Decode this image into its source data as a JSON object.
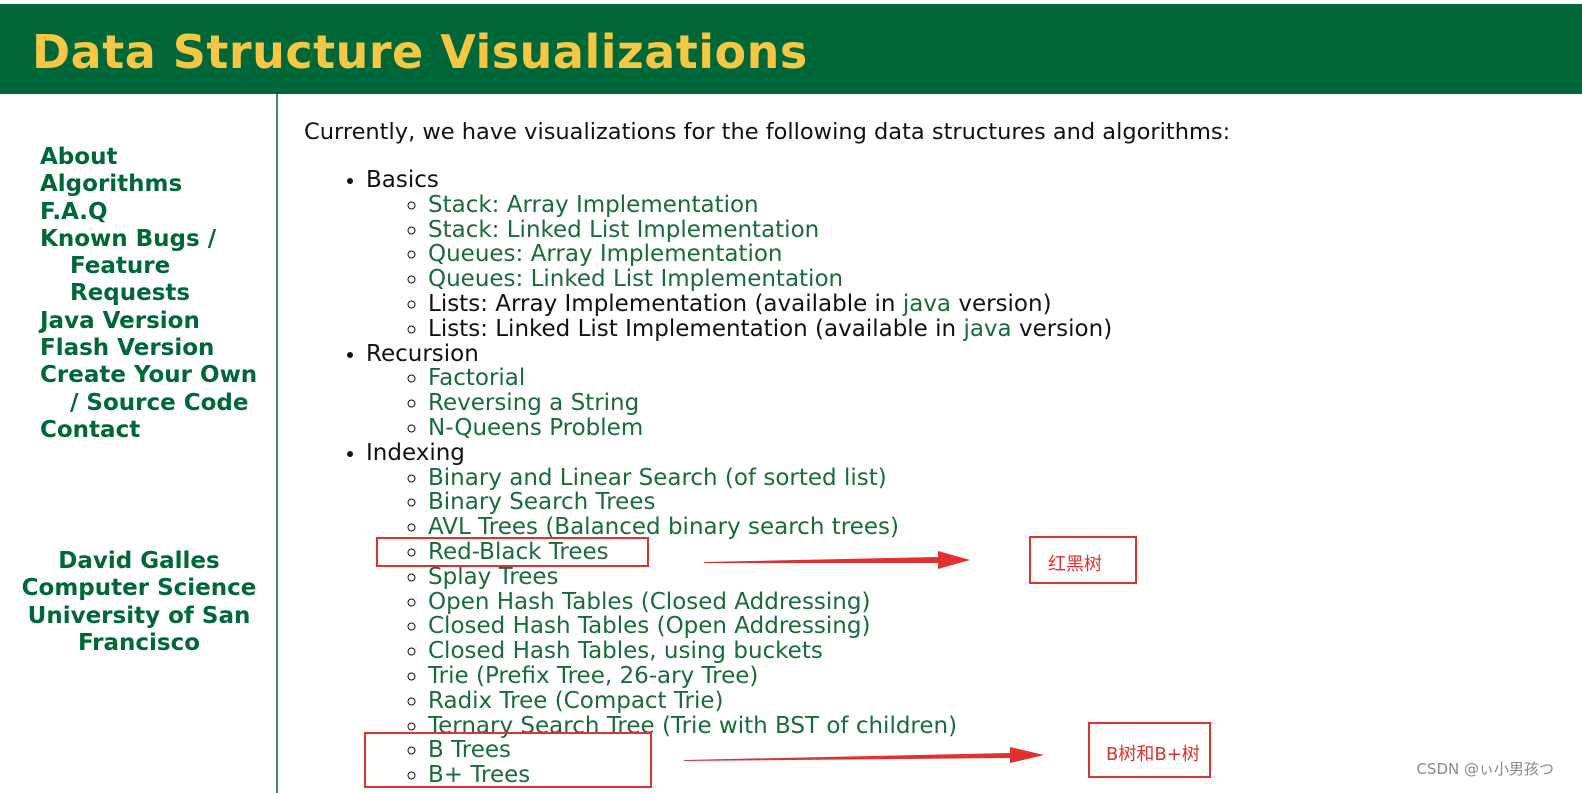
{
  "header": {
    "title": "Data Structure Visualizations"
  },
  "sidebar": {
    "links": [
      "About",
      "Algorithms",
      "F.A.Q",
      "Known Bugs / Feature Requests",
      "Java Version",
      "Flash Version",
      "Create Your Own / Source Code",
      "Contact"
    ],
    "author": [
      "David Galles",
      "Computer Science",
      "University of San",
      "Francisco"
    ]
  },
  "main": {
    "intro": "Currently, we have visualizations for the following data structures and algorithms:",
    "categories": [
      {
        "name": "Basics",
        "items": [
          "Stack: Array Implementation",
          "Stack: Linked List Implementation",
          "Queues: Array Implementation",
          "Queues: Linked List Implementation"
        ],
        "java_items": [
          {
            "prefix": "Lists: Array Implementation (available in ",
            "link": "java",
            "suffix": " version)"
          },
          {
            "prefix": "Lists: Linked List Implementation (available in ",
            "link": "java",
            "suffix": " version)"
          }
        ]
      },
      {
        "name": "Recursion",
        "items": [
          "Factorial",
          "Reversing a String",
          "N-Queens Problem"
        ]
      },
      {
        "name": "Indexing",
        "items": [
          "Binary and Linear Search (of sorted list)",
          "Binary Search Trees",
          "AVL Trees (Balanced binary search trees)",
          "Red-Black Trees",
          "Splay Trees",
          "Open Hash Tables (Closed Addressing)",
          "Closed Hash Tables (Open Addressing)",
          "Closed Hash Tables, using buckets",
          "Trie (Prefix Tree, 26-ary Tree)",
          "Radix Tree (Compact Trie)",
          "Ternary Search Tree (Trie with BST of children)",
          "B Trees",
          "B+ Trees"
        ]
      }
    ]
  },
  "annotations": {
    "red_black_note": "红黑树",
    "b_tree_note": "B树和B+树",
    "color": "#e03030"
  },
  "watermark": "CSDN @ぃ小男孩つ",
  "colors": {
    "header_bg": "#006838",
    "title": "#f6c744",
    "link": "#1a6b3a",
    "sidebar_link": "#006838"
  }
}
